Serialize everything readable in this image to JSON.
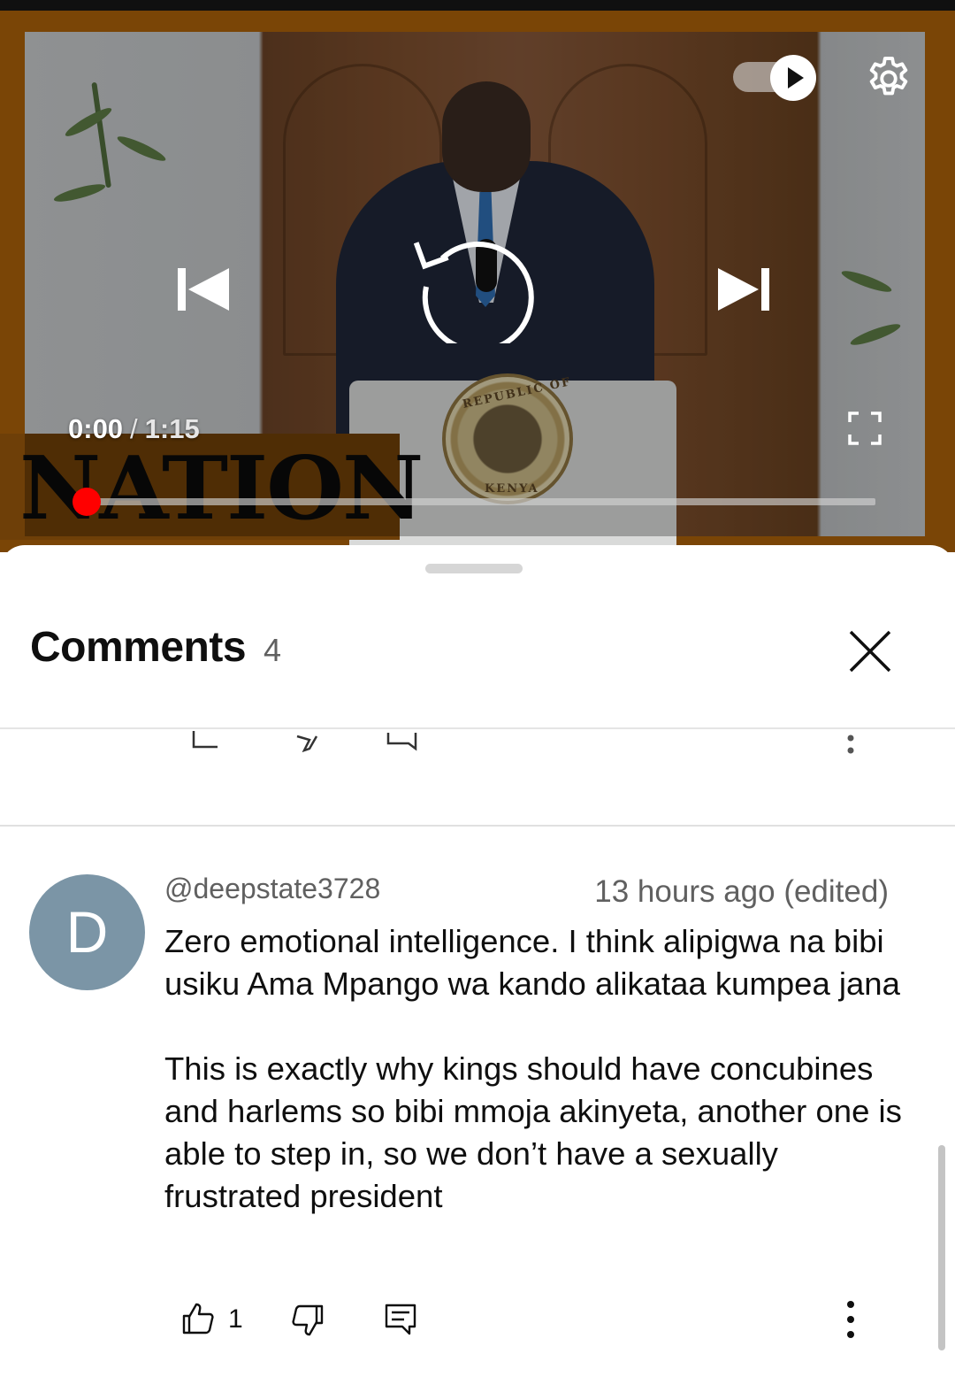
{
  "player": {
    "watermark": "NATION",
    "seal_top": "REPUBLIC OF",
    "seal_bottom": "KENYA",
    "time_current": "0:00",
    "time_separator": "/",
    "time_total": "1:15",
    "progress_fraction": 0.0,
    "autoplay_on": true,
    "icons": [
      "autoplay-toggle",
      "gear-icon",
      "previous-icon",
      "replay-icon",
      "next-icon",
      "fullscreen-icon"
    ],
    "accent_color": "#ff0000"
  },
  "comments_panel": {
    "title": "Comments",
    "count": "4",
    "close_icon": "close-icon"
  },
  "comment": {
    "avatar_letter": "D",
    "avatar_color": "#7b95a6",
    "author": "@deepstate3728",
    "time": "13 hours ago (edited)",
    "text": "Zero emotional intelligence. I think alipigwa na bibi usiku Ama Mpango wa kando alikataa kumpea jana\n\nThis is exactly why kings should have concubines and harlems so bibi mmoja akinyeta, another one is able to step in, so we don’t have a sexually frustrated president",
    "likes": "1",
    "icons": [
      "like-icon",
      "dislike-icon",
      "reply-icon",
      "more-vert-icon"
    ]
  }
}
